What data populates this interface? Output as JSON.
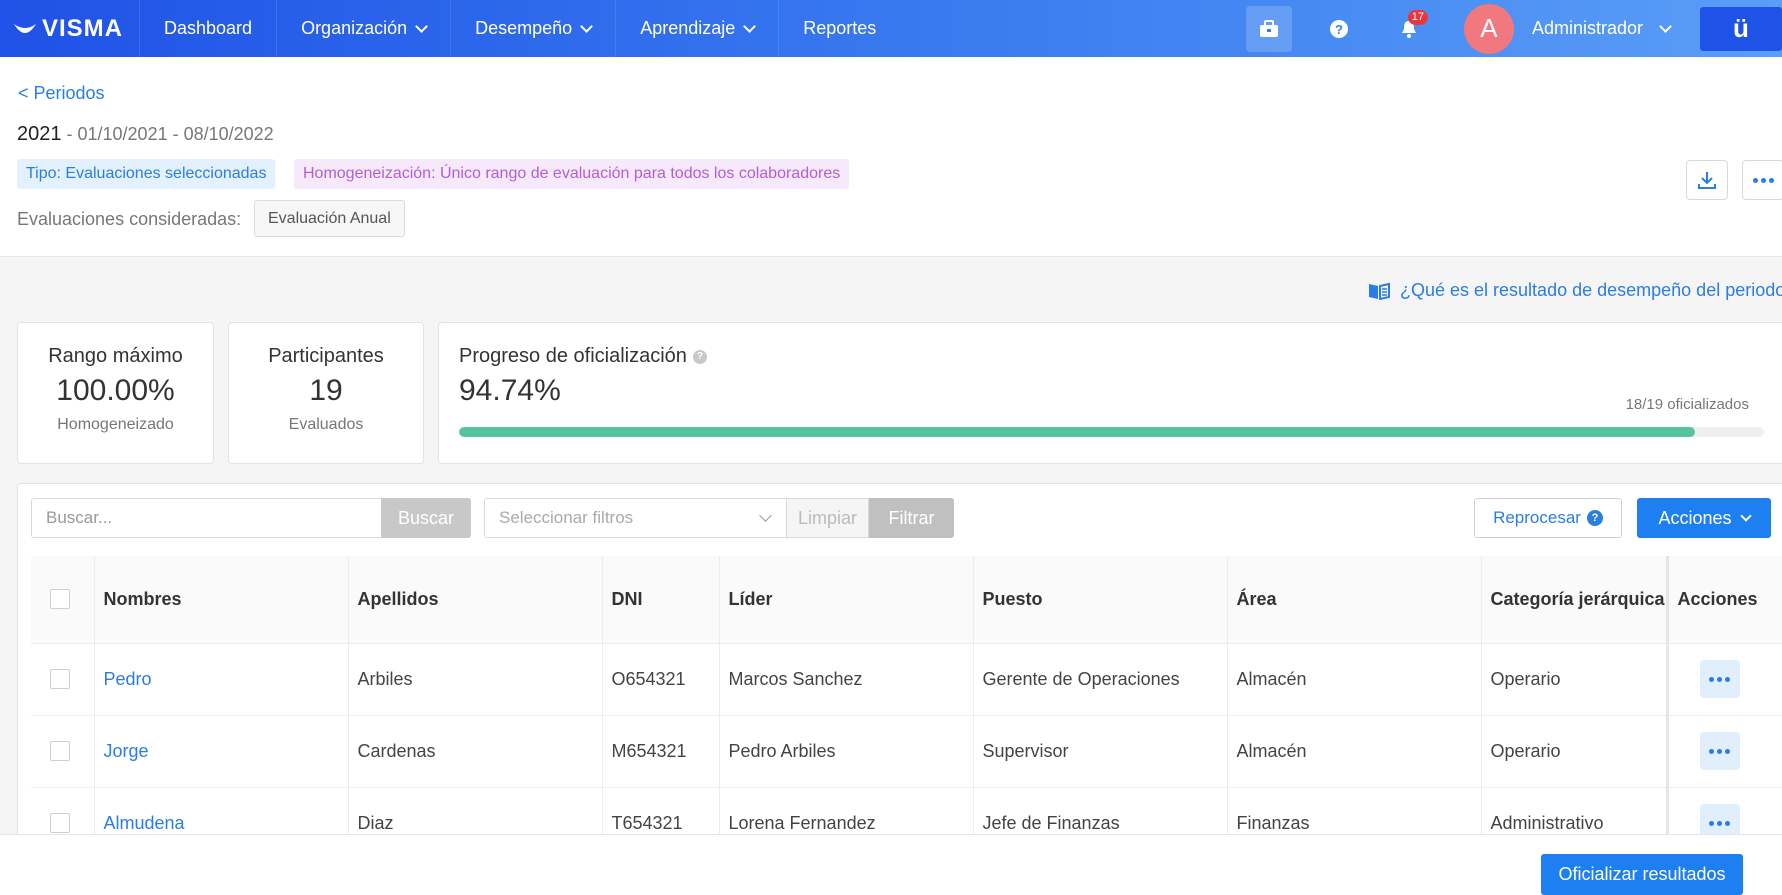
{
  "nav": {
    "brand": "VISMA",
    "items": [
      {
        "label": "Dashboard",
        "has_dropdown": false
      },
      {
        "label": "Organización",
        "has_dropdown": true
      },
      {
        "label": "Desempeño",
        "has_dropdown": true
      },
      {
        "label": "Aprendizaje",
        "has_dropdown": true
      },
      {
        "label": "Reportes",
        "has_dropdown": false
      }
    ],
    "notification_count": "17",
    "avatar_letter": "A",
    "user_name": "Administrador",
    "app_icon": "ü",
    "icons": [
      "briefcase-icon",
      "help-icon",
      "bell-icon",
      "chevron-down-icon"
    ]
  },
  "header": {
    "back_label": "< Periodos",
    "year": "2021",
    "date_range": " - 01/10/2021 - 08/10/2022",
    "tag_type": "Tipo: Evaluaciones seleccionadas",
    "tag_homogenization": "Homogeneización: Único rango de evaluación para todos los colaboradores",
    "evaluations_label": "Evaluaciones consideradas:",
    "evaluation_chip": "Evaluación Anual"
  },
  "help_link": "¿Qué es el resultado de desempeño del periodo?",
  "stats": {
    "max_range": {
      "title": "Rango máximo",
      "value": "100.00%",
      "sub": "Homogeneizado"
    },
    "participants": {
      "title": "Participantes",
      "value": "19",
      "sub": "Evaluados"
    },
    "progress": {
      "title": "Progreso de oficialización",
      "value": "94.74%",
      "count": "18/19 oficializados",
      "fraction": 0.9474
    }
  },
  "toolbar": {
    "search_placeholder": "Buscar...",
    "search_button": "Buscar",
    "filter_placeholder": "Seleccionar filtros",
    "clear_button": "Limpiar",
    "filter_button": "Filtrar",
    "reprocess_button": "Reprocesar",
    "actions_button": "Acciones"
  },
  "table": {
    "columns": [
      "Nombres",
      "Apellidos",
      "DNI",
      "Líder",
      "Puesto",
      "Área",
      "Categoría jerárquica",
      "Acciones"
    ],
    "rows": [
      {
        "nombre": "Pedro",
        "apellido": "Arbiles",
        "dni": "O654321",
        "lider": "Marcos Sanchez",
        "puesto": "Gerente de Operaciones",
        "area": "Almacén",
        "categoria": "Operario"
      },
      {
        "nombre": "Jorge",
        "apellido": "Cardenas",
        "dni": "M654321",
        "lider": "Pedro Arbiles",
        "puesto": "Supervisor",
        "area": "Almacén",
        "categoria": "Operario"
      },
      {
        "nombre": "Almudena",
        "apellido": "Diaz",
        "dni": "T654321",
        "lider": "Lorena Fernandez",
        "puesto": "Jefe de Finanzas",
        "area": "Finanzas",
        "categoria": "Administrativo"
      }
    ]
  },
  "footer": {
    "officialize_button": "Oficializar resultados"
  },
  "colors": {
    "primary": "#1e7ff0",
    "link": "#2a7de1",
    "progress": "#55c3a1",
    "tag_type_bg": "#e3f0fd",
    "tag_homo_bg": "#f6e9fb"
  }
}
